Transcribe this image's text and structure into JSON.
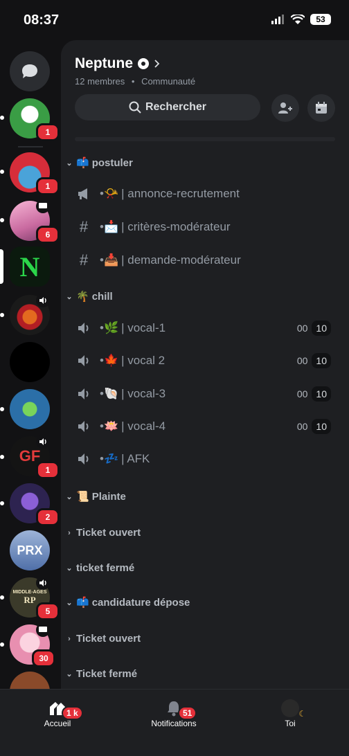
{
  "status_bar": {
    "time": "08:37",
    "battery": "53"
  },
  "server": {
    "name": "Neptune",
    "members": "12 membres",
    "type": "Communauté",
    "search_label": "Rechercher"
  },
  "rail_badges": {
    "s1": "1",
    "s2": "1",
    "s3": "6",
    "s8": "1",
    "s9": "2",
    "s11": "5",
    "s12": "30"
  },
  "rail_text": {
    "prx": "PRX",
    "mid": "MIDDLE-AGES",
    "rp": "RP"
  },
  "categories": [
    {
      "label": "postuler",
      "emoji": "📫"
    },
    {
      "label": "chill",
      "emoji": "🌴"
    },
    {
      "label": "Plainte",
      "emoji": "📜"
    },
    {
      "label": "Ticket ouvert"
    },
    {
      "label": "ticket fermé"
    },
    {
      "label": "candidature dépose",
      "emoji": "📫"
    },
    {
      "label": "Ticket ouvert"
    },
    {
      "label": "Ticket fermé"
    }
  ],
  "channels": [
    {
      "emoji": "•📯",
      "name": "| annonce-recrutement"
    },
    {
      "emoji": "•📩",
      "name": "| critères-modérateur"
    },
    {
      "emoji": "•📥",
      "name": "| demande-modérateur"
    },
    {
      "emoji": "•🌿",
      "name": "| vocal-1",
      "count": "00",
      "cap": "10"
    },
    {
      "emoji": "•🍁",
      "name": "| vocal 2",
      "count": "00",
      "cap": "10"
    },
    {
      "emoji": "•🐚",
      "name": "| vocal-3",
      "count": "00",
      "cap": "10"
    },
    {
      "emoji": "•🪷",
      "name": "| vocal-4",
      "count": "00",
      "cap": "10"
    },
    {
      "emoji": "•💤",
      "name": "| AFK"
    }
  ],
  "nav": {
    "home": "Accueil",
    "home_badge": "1 k",
    "notifications": "Notifications",
    "notif_badge": "51",
    "you": "Toi"
  }
}
